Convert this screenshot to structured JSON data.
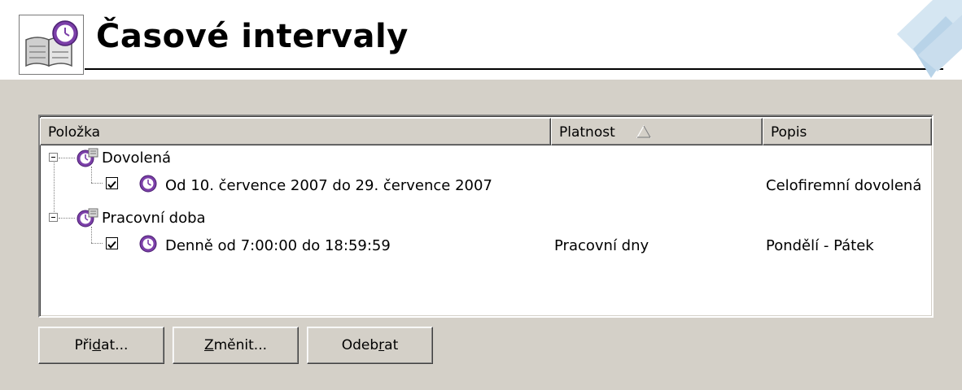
{
  "header": {
    "title": "Časové intervaly"
  },
  "list": {
    "columns": [
      {
        "label": "Položka"
      },
      {
        "label": "Platnost",
        "sort": "ascending"
      },
      {
        "label": "Popis"
      }
    ],
    "groups": [
      {
        "label": "Dovolená",
        "expanded": true,
        "items": [
          {
            "checked": true,
            "label": "Od 10. července 2007 do 29. července 2007",
            "platnost": "",
            "popis": "Celofiremní dovolená"
          }
        ]
      },
      {
        "label": "Pracovní doba",
        "expanded": true,
        "items": [
          {
            "checked": true,
            "label": "Denně od 7:00:00 do 18:59:59",
            "platnost": "Pracovní dny",
            "popis": "Pondělí - Pátek"
          }
        ]
      }
    ]
  },
  "buttons": {
    "add": {
      "pre": "Při",
      "accel": "d",
      "post": "at..."
    },
    "change": {
      "pre": "",
      "accel": "Z",
      "post": "měnit..."
    },
    "remove": {
      "pre": "Odeb",
      "accel": "r",
      "post": "at"
    }
  },
  "icons": {
    "header": "book-clock-icon",
    "group": "clock-group-icon",
    "item": "clock-icon",
    "sort": "sort-ascending-icon"
  },
  "colors": {
    "panel": "#d4d0c8",
    "clock": "#7b3fa8",
    "clock_face": "#ffffff"
  }
}
